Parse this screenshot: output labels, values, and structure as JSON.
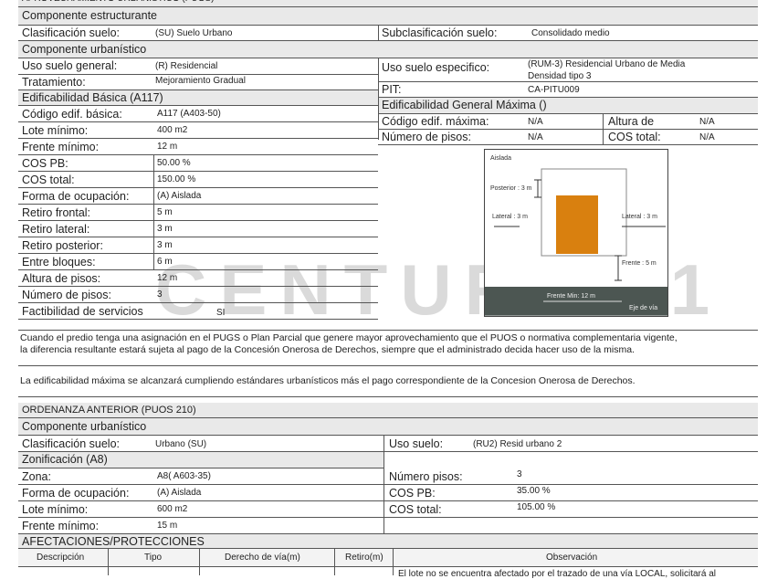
{
  "top_header": "APROVECHAMIENTO URBANÍSTICO (PUGS)",
  "componente_estructurante": "Componente estructurante",
  "clasificacion": {
    "label": "Clasificación suelo:",
    "value": "(SU) Suelo Urbano"
  },
  "subclasificacion": {
    "label": "Subclasificación suelo:",
    "value": "Consolidado medio"
  },
  "componente_urbanistico": "Componente urbanístico",
  "uso_general": {
    "label": "Uso suelo general:",
    "value": "(R) Residencial"
  },
  "uso_especifico": {
    "label": "Uso suelo especifico:",
    "value_line1": "(RUM-3) Residencial Urbano de Media",
    "value_line2": "Densidad tipo 3"
  },
  "tratamiento": {
    "label": "Tratamiento:",
    "value": "Mejoramiento Gradual"
  },
  "pit": {
    "label": "PIT:",
    "value": "CA-PITU009"
  },
  "edif_basica_header": "Edificabilidad Básica (A117)",
  "edif_maxima_header": "Edificabilidad General Máxima ()",
  "left_rows": [
    {
      "label": "Código edif. básica:",
      "value": "A117 (A403-50)"
    },
    {
      "label": "Lote mínimo:",
      "value": "400 m2"
    },
    {
      "label": "Frente mínimo:",
      "value": "12 m"
    },
    {
      "label": "COS PB:",
      "value": "50.00 %"
    },
    {
      "label": "COS total:",
      "value": "150.00 %"
    },
    {
      "label": "Forma de ocupación:",
      "value": "(A) Aislada"
    },
    {
      "label": "Retiro frontal:",
      "value": "5 m"
    },
    {
      "label": "Retiro lateral:",
      "value": "3 m"
    },
    {
      "label": "Retiro posterior:",
      "value": "3 m"
    },
    {
      "label": "Entre bloques:",
      "value": "6 m"
    },
    {
      "label": "Altura de pisos:",
      "value": "12 m"
    },
    {
      "label": "Número de pisos:",
      "value": "3"
    },
    {
      "label": "Factibilidad de servicios",
      "value": "SI"
    }
  ],
  "max_rows": [
    {
      "label": "Código edif. máxima:",
      "value": "N/A",
      "label2": "Altura de",
      "value2": "N/A"
    },
    {
      "label": "Número de pisos:",
      "value": "N/A",
      "label2": "COS total:",
      "value2": "N/A"
    }
  ],
  "diagram": {
    "aislada": "Aislada",
    "posterior": "Posterior : 3 m",
    "lateral_left": "Lateral : 3 m",
    "lateral_right": "Lateral : 3 m",
    "frente": "Frente : 5 m",
    "frente_min": "Frente Min: 12 m",
    "eje": "Eje de vía",
    "building_color": "#d9800f",
    "road_color": "#4c5652"
  },
  "note1_line1": "Cuando el predio tenga una asignación en el PUGS o Plan Parcial que genere mayor aprovechamiento que el PUOS o normativa complementaria vigente,",
  "note1_line2": "la diferencia resultante estará sujeta al pago de la Concesión Onerosa de Derechos, siempre que el administrado decida hacer uso de la misma.",
  "note2": "La edificabilidad máxima se alcanzará cumpliendo estándares urbanísticos más el pago correspondiente de la Concesion Onerosa de Derechos.",
  "ordenanza_header": "ORDENANZA ANTERIOR (PUOS 210)",
  "ord_componente": "Componente urbanístico",
  "ord_clasificacion": {
    "label": "Clasificación suelo:",
    "value": "Urbano (SU)"
  },
  "ord_uso": {
    "label": "Uso suelo:",
    "value": "(RU2) Resid urbano 2"
  },
  "zonificacion_header": "Zonificación (A8)",
  "ord_rows": [
    {
      "label": "Zona:",
      "value": "A8( A603-35)",
      "label2": "Número pisos:",
      "value2": "3"
    },
    {
      "label": "Forma de ocupación:",
      "value": "(A) Aislada",
      "label2": "COS PB:",
      "value2": "35.00 %"
    },
    {
      "label": "Lote mínimo:",
      "value": "600 m2",
      "label2": "COS total:",
      "value2": "105.00 %"
    },
    {
      "label": "Frente mínimo:",
      "value": "15 m",
      "label2": "",
      "value2": ""
    }
  ],
  "afectaciones_header": "AFECTACIONES/PROTECCIONES",
  "afect_cols": [
    "Descripción",
    "Tipo",
    "Derecho de vía(m)",
    "Retiro(m)",
    "Observación"
  ],
  "afect_row_obs": "El lote no se encuentra afectado por el trazado de una vía LOCAL, solicitará al",
  "watermark": "CENTURY 21"
}
